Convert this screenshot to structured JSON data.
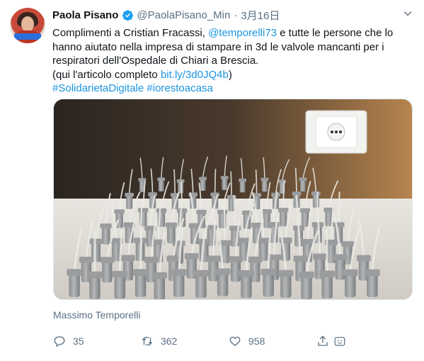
{
  "author": {
    "name": "Paola Pisano",
    "handle": "@PaolaPisano_Min",
    "separator": "·",
    "date": "3月16日"
  },
  "tweet": {
    "text_line1_a": "Complimenti a Cristian Fracassi, ",
    "mention": "@temporelli73",
    "text_line1_b": "  e tutte le persone che lo hanno aiutato nella impresa di stampare in 3d le valvole mancanti per i respiratori dell'Ospedale di Chiari a Brescia.",
    "article_prefix": "(qui l'articolo completo ",
    "article_link": "bit.ly/3d0JQ4b",
    "article_suffix": ")",
    "hashtags": "#SolidarietaDigitale #iorestoacasa"
  },
  "media": {
    "credit": "Massimo Temporelli"
  },
  "actions": {
    "replies": "35",
    "retweets": "362",
    "likes": "958"
  },
  "icons": {
    "verified": "verified-badge-icon",
    "more": "chevron-down-icon",
    "reply": "reply-icon",
    "retweet": "retweet-icon",
    "like": "heart-icon",
    "share": "share-icon"
  },
  "colors": {
    "link": "#1b95e0",
    "muted": "#5b7083",
    "verified": "#1da1f2"
  }
}
